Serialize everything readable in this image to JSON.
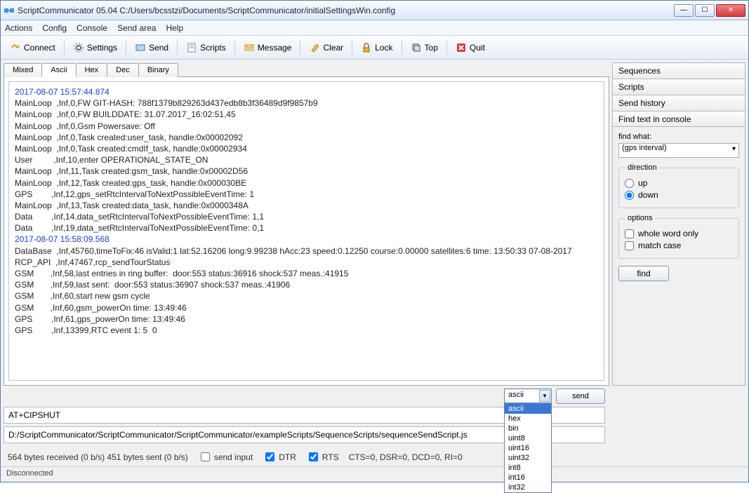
{
  "title": "ScriptCommunicator 05.04   C:/Users/bcsstzi/Documents/ScriptCommunicator/initialSettingsWin.config",
  "menu": [
    "Actions",
    "Config",
    "Console",
    "Send area",
    "Help"
  ],
  "toolbar": [
    {
      "id": "connect",
      "label": "Connect"
    },
    {
      "id": "settings",
      "label": "Settings"
    },
    {
      "id": "send",
      "label": "Send"
    },
    {
      "id": "scripts",
      "label": "Scripts"
    },
    {
      "id": "message",
      "label": "Message"
    },
    {
      "id": "clear",
      "label": "Clear"
    },
    {
      "id": "lock",
      "label": "Lock"
    },
    {
      "id": "top",
      "label": "Top"
    },
    {
      "id": "quit",
      "label": "Quit"
    }
  ],
  "tabs": [
    "Mixed",
    "Ascii",
    "Hex",
    "Dec",
    "Binary"
  ],
  "active_tab": 1,
  "console": [
    {
      "ts": "2017-08-07 15:57:44.874"
    },
    "MainLoop  ,Inf,0,FW GIT-HASH: 788f1379b829263d437edb8b3f36489d9f9857b9",
    "MainLoop  ,Inf,0,FW BUILDDATE: 31.07.2017_16:02:51,45",
    "MainLoop  ,Inf,0,Gsm Powersave: Off",
    "MainLoop  ,Inf,0,Task created:user_task, handle:0x00002092",
    "MainLoop  ,Inf,0,Task created:cmdIf_task, handle:0x00002934",
    "User         ,Inf,10,enter OPERATIONAL_STATE_ON",
    "MainLoop  ,Inf,11,Task created:gsm_task, handle:0x00002D56",
    "MainLoop  ,Inf,12,Task created:gps_task, handle:0x000030BE",
    "GPS        ,Inf,12,gps_setRtcIntervalToNextPossibleEventTime: 1",
    "MainLoop  ,Inf,13,Task created:data_task, handle:0x0000348A",
    "Data        ,Inf,14,data_setRtcIntervalToNextPossibleEventTime: 1,1",
    "Data        ,Inf,19,data_setRtcIntervalToNextPossibleEventTime: 0,1",
    {
      "ts": "2017-08-07 15:58:09.568"
    },
    "DataBase  ,Inf,45760,timeToFix:46 isValid:1 lat:52.16206 long:9.99238 hAcc:23 speed:0.12250 course:0.00000 satellites:6 time: 13:50:33 07-08-2017",
    "RCP_API  ,Inf,47467,rcp_sendTourStatus",
    "GSM       ,Inf,58,last entries in ring buffer:  door:553 status:36916 shock:537 meas.:41915",
    "GSM       ,Inf,59,last sent:  door:553 status:36907 shock:537 meas.:41906",
    "GSM       ,Inf,60,start new gsm cycle",
    "GSM       ,Inf,60,gsm_powerOn time: 13:49:46",
    "GPS        ,Inf,61,gps_powerOn time: 13:49:46",
    "GPS        ,Inf,13399,RTC event 1: 5  0"
  ],
  "accordion": [
    "Sequences",
    "Scripts",
    "Send history",
    "Find text in console"
  ],
  "find": {
    "label": "find what:",
    "value": "(gps interval)",
    "direction_label": "direction",
    "dir_up": "up",
    "dir_down": "down",
    "dir_selected": "down",
    "options_label": "options",
    "opt_whole": "whole word only",
    "opt_case": "match case",
    "button": "find"
  },
  "send": {
    "format_selected": "ascii",
    "options": [
      "ascii",
      "hex",
      "bin",
      "uint8",
      "uint16",
      "uint32",
      "int8",
      "int16",
      "int32"
    ],
    "button": "send",
    "input": "AT+CIPSHUT",
    "script_path": "D:/ScriptCommunicator/ScriptCommunicator/ScriptCommunicator/exampleScripts/SequenceScripts/sequenceSendScript.js"
  },
  "infobar": {
    "stats": "564 bytes received (0 b/s)  451 bytes sent (0 b/s)",
    "send_input": "send input",
    "dtr": "DTR",
    "rts": "RTS",
    "lines": "CTS=0, DSR=0, DCD=0, RI=0"
  },
  "status": "Disconnected"
}
